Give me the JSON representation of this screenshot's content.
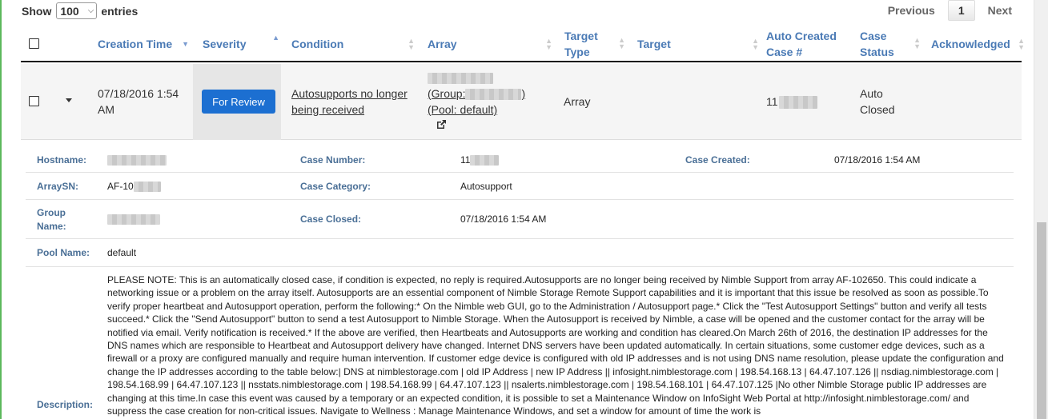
{
  "length_menu": {
    "show_label": "Show",
    "selected": "100",
    "entries_label": "entries"
  },
  "pager": {
    "previous": "Previous",
    "current": "1",
    "next": "Next"
  },
  "columns": {
    "creation_time": "Creation Time",
    "severity": "Severity",
    "condition": "Condition",
    "array": "Array",
    "target_type_1": "Target",
    "target_type_2": "Type",
    "target": "Target",
    "auto_case_1": "Auto Created",
    "auto_case_2": "Case #",
    "case_status_1": "Case",
    "case_status_2": "Status",
    "acknowledged": "Acknowledged"
  },
  "row": {
    "creation_time_1": "07/18/2016 1:54",
    "creation_time_2": "AM",
    "severity_button": "For Review",
    "condition_1": "Autosupports no longer",
    "condition_2": "being received",
    "array_group_prefix": "(Group:",
    "array_group_suffix": ")",
    "array_pool": "(Pool: default)",
    "target_type": "Array",
    "case_prefix": "11",
    "case_status_1": "Auto",
    "case_status_2": "Closed"
  },
  "details": {
    "hostname_label": "Hostname:",
    "case_number_label": "Case Number:",
    "case_number_prefix": "11",
    "case_created_label": "Case Created:",
    "case_created_value": "07/18/2016 1:54 AM",
    "arraysn_label": "ArraySN:",
    "arraysn_prefix": "AF-10",
    "case_category_label": "Case Category:",
    "case_category_value": "Autosupport",
    "group_name_label_1": "Group",
    "group_name_label_2": "Name:",
    "case_closed_label": "Case Closed:",
    "case_closed_value": "07/18/2016 1:54 AM",
    "pool_name_label": "Pool Name:",
    "pool_name_value": "default",
    "description_label": "Description:",
    "description_text": "PLEASE NOTE: This is an automatically closed case, if condition is expected, no reply is required.Autosupports are no longer being received by Nimble Support from array AF-102650. This could indicate a networking issue or a problem on the array itself. Autosupports are an essential component of Nimble Storage Remote Support capabilities and it is important that this issue be resolved as soon as possible.To verify proper heartbeat and Autosupport operation, perform the following:* On the Nimble web GUI, go to the Administration / Autosupport page.* Click the \"Test Autosupport Settings\" button and verify all tests succeed.* Click the \"Send Autosupport\" button to send a test Autosupport to Nimble Storage. When the Autosupport is received by Nimble, a case will be opened and the customer contact for the array will be notified via email. Verify notification is received.* If the above are verified, then Heartbeats and Autosupports are working and condition has cleared.On March 26th of 2016, the destination IP addresses for the DNS names which are responsible to Heartbeat and Autosupport delivery have changed. Internet DNS servers have been updated automatically. In certain situations, some customer edge devices, such as a firewall or a proxy are configured manually and require human intervention. If customer edge device is configured with old IP addresses and is not using DNS name resolution, please update the configuration and change the IP addresses according to the table below:| DNS at nimblestorage.com | old IP Address | new IP Address || infosight.nimblestorage.com | 198.54.168.13 | 64.47.107.126 || nsdiag.nimblestorage.com | 198.54.168.99 | 64.47.107.123 || nsstats.nimblestorage.com | 198.54.168.99 | 64.47.107.123 || nsalerts.nimblestorage.com | 198.54.168.101 | 64.47.107.125 |No other Nimble Storage public IP addresses are changing at this time.In case this event was caused by a temporary or an expected condition, it is possible to set a Maintenance Window on InfoSight Web Portal at http://infosight.nimblestorage.com/ and suppress the case creation for non-critical issues. Navigate to Wellness : Manage Maintenance Windows, and set a window for amount of time the work is"
  },
  "colors": {
    "header_text": "#4a7ab5",
    "button": "#1c6fd1",
    "label": "#4a6f96",
    "frame": "#5cb85c"
  }
}
